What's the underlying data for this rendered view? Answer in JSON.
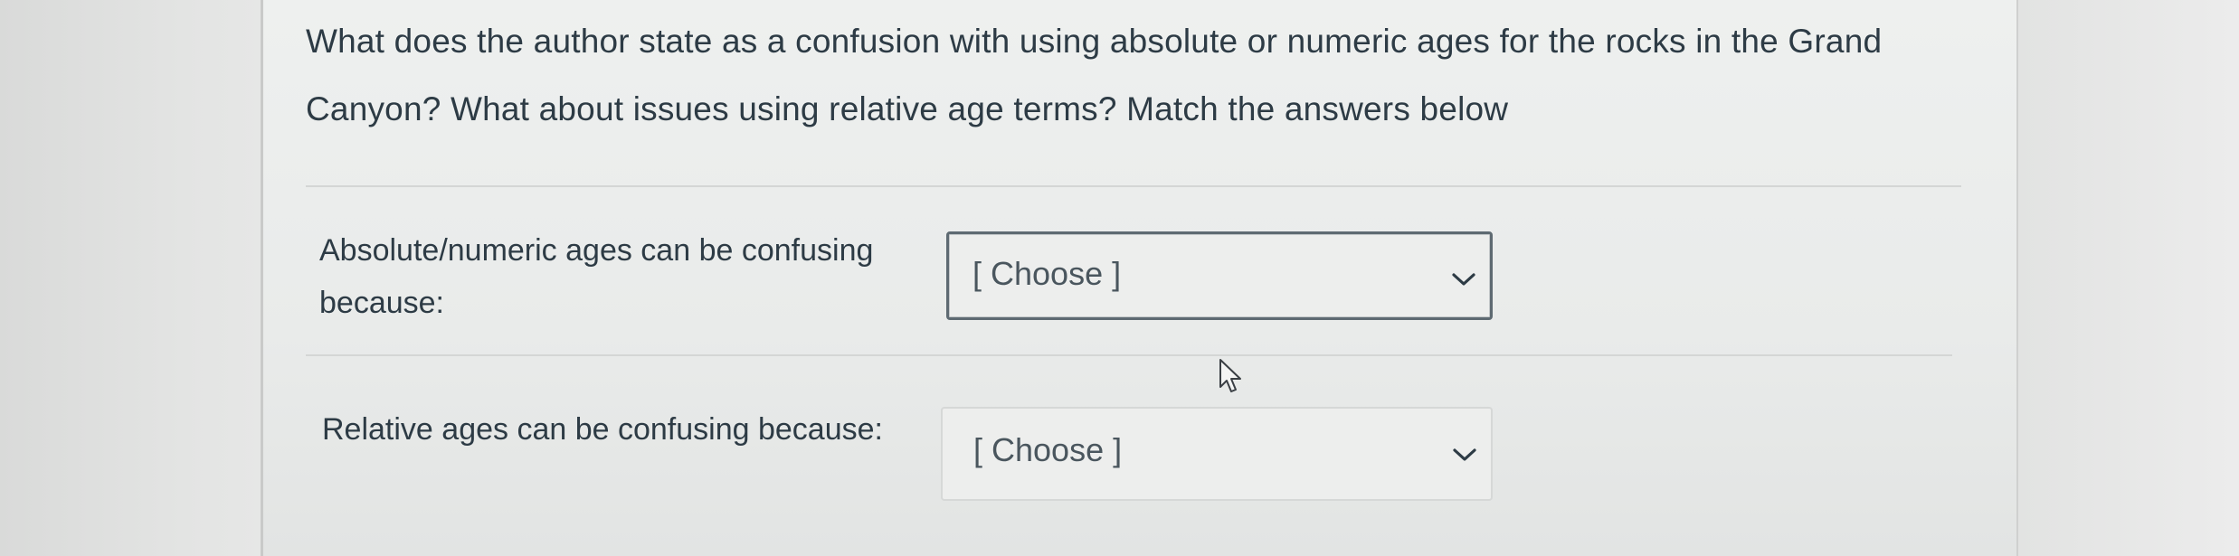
{
  "question": {
    "text": "What does the author state as a confusion with using absolute or numeric ages for the rocks in the Grand Canyon? What about issues using relative age terms? Match the answers below"
  },
  "matches": [
    {
      "label": "Absolute/numeric ages can be confusing because:",
      "selected": "[ Choose ]",
      "icon": "chevron-down-icon"
    },
    {
      "label": "Relative ages can be confusing because:",
      "selected": "[ Choose ]",
      "icon": "chevron-down-icon"
    }
  ],
  "colors": {
    "text": "#2d3b45",
    "select_text": "#4a565e",
    "focused_border": "#5e6a72",
    "panel_background": "#eef0ef"
  }
}
